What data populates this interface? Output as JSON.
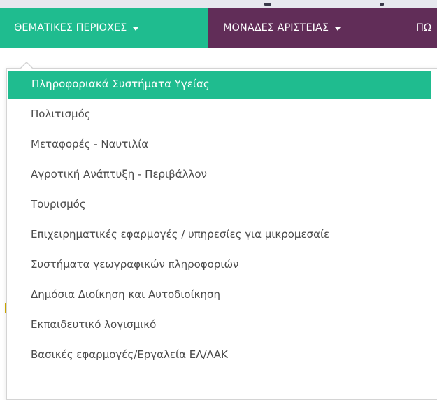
{
  "navbar": {
    "thematic_label": "ΘΕΜΑΤΙΚΕΣ ΠΕΡΙΟΧΕΣ",
    "excellence_label": "ΜΟΝΑΔΕΣ ΑΡΙΣΤΕΙΑΣ",
    "more_label": "ΠΩ"
  },
  "dropdown": {
    "items": [
      {
        "label": "Πληροφοριακά Συστήματα Υγείας"
      },
      {
        "label": "Πολιτισμός"
      },
      {
        "label": "Μεταφορές - Ναυτιλία"
      },
      {
        "label": "Αγροτική Ανάπτυξη - Περιβάλλον"
      },
      {
        "label": "Τουρισμός"
      },
      {
        "label": "Επιχειρηματικές εφαρμογές / υπηρεσίες για μικρομεσαίε"
      },
      {
        "label": "Συστήματα γεωγραφικών πληροφοριών"
      },
      {
        "label": "Δημόσια Διοίκηση και Αυτοδιοίκηση"
      },
      {
        "label": "Εκπαιδευτικό λογισμικό"
      },
      {
        "label": "Βασικές εφαρμογές/Εργαλεία ΕΛ/ΛΑΚ"
      }
    ]
  },
  "colors": {
    "accent_green": "#1fbc8f",
    "nav_purple": "#612d58",
    "menu_text": "#4a4a4a"
  }
}
